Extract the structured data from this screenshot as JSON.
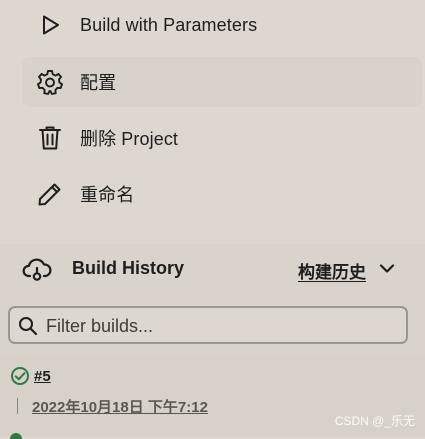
{
  "sidebar": {
    "items": [
      {
        "label": "Build with Parameters",
        "icon": "play-icon"
      },
      {
        "label": "配置",
        "icon": "gear-icon"
      },
      {
        "label": "删除 Project",
        "icon": "trash-icon"
      },
      {
        "label": "重命名",
        "icon": "pencil-icon"
      }
    ]
  },
  "build_history": {
    "title": "Build History",
    "link_label": "构建历史",
    "icon": "cloud-history-icon",
    "chevron_icon": "chevron-down-icon",
    "filter": {
      "placeholder": "Filter builds...",
      "value": "",
      "icon": "search-icon"
    },
    "builds": [
      {
        "number": "#5",
        "status": "success",
        "status_icon": "check-circle-icon",
        "date": "2022年10月18日 下午7:12"
      }
    ]
  },
  "watermark": "CSDN @_乐无",
  "colors": {
    "background": "#ddd7cf",
    "panel": "#d9d3cb",
    "success": "#2d7a45",
    "text": "#1e1e1e"
  }
}
